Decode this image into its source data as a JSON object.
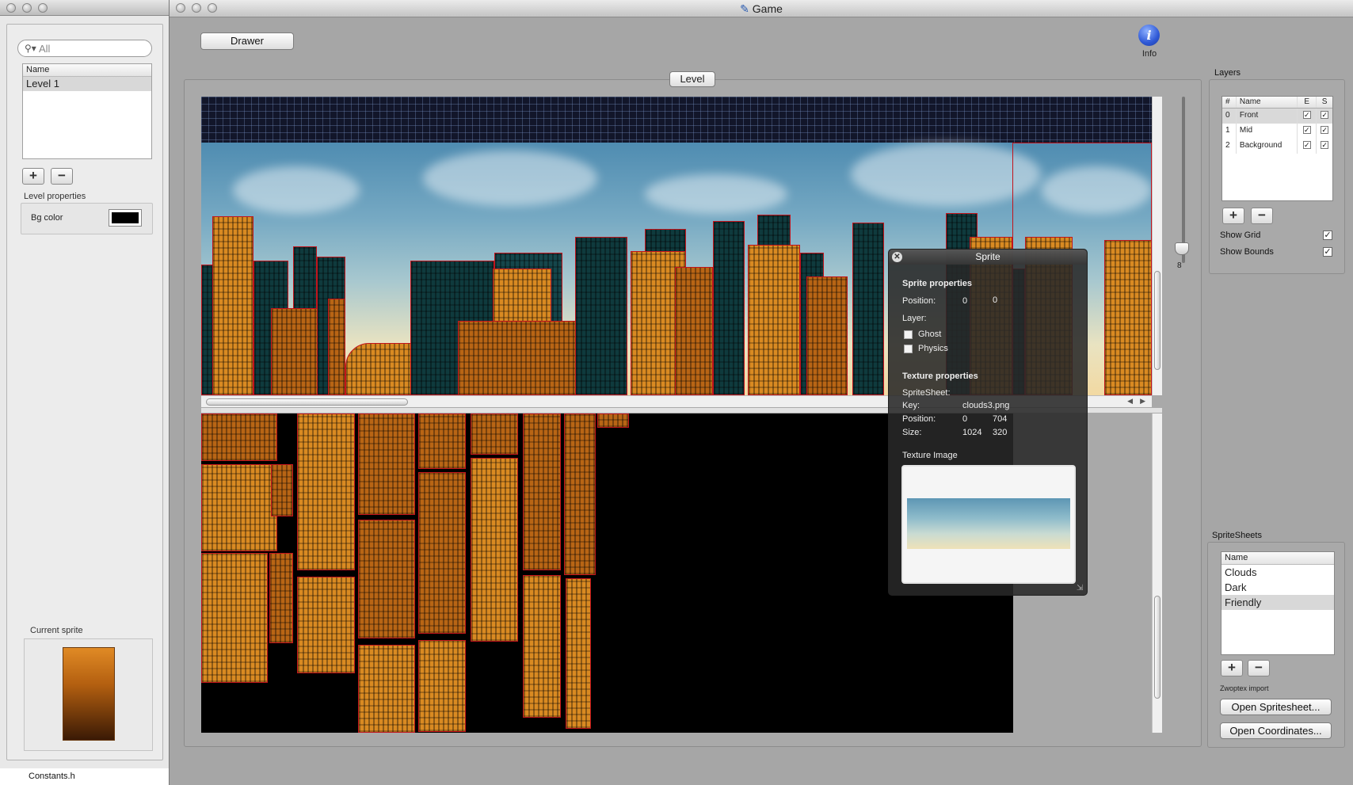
{
  "drawer": {
    "search_placeholder": "All",
    "list_header": "Name",
    "levels": [
      "Level 1"
    ],
    "add_label": "+",
    "remove_label": "−",
    "level_properties_title": "Level properties",
    "bg_color_label": "Bg color",
    "bg_color": "#000000",
    "current_sprite_title": "Current sprite"
  },
  "background_file": "Constants.h",
  "window": {
    "title": "Game",
    "drawer_button": "Drawer",
    "info_label": "Info",
    "info_glyph": "i",
    "level_tab": "Level",
    "zoom_value": "8"
  },
  "layers": {
    "title": "Layers",
    "headers": [
      "#",
      "Name",
      "E",
      "S"
    ],
    "rows": [
      {
        "num": "0",
        "name": "Front",
        "e": true,
        "s": true
      },
      {
        "num": "1",
        "name": "Mid",
        "e": true,
        "s": true
      },
      {
        "num": "2",
        "name": "Background",
        "e": true,
        "s": true
      }
    ],
    "add_label": "+",
    "remove_label": "−",
    "show_grid": "Show Grid",
    "show_grid_checked": true,
    "show_bounds": "Show Bounds",
    "show_bounds_checked": true
  },
  "spritesheets": {
    "title": "SpriteSheets",
    "header": "Name",
    "items": [
      "Clouds",
      "Dark",
      "Friendly"
    ],
    "selected": "Friendly",
    "add_label": "+",
    "remove_label": "−",
    "zwoptex_label": "Zwoptex import",
    "open_spritesheet": "Open Spritesheet...",
    "open_coordinates": "Open Coordinates..."
  },
  "sprite_hud": {
    "title": "Sprite",
    "close_glyph": "✕",
    "sprite_properties": "Sprite properties",
    "position_label": "Position:",
    "position_x": "0",
    "position_y": "0",
    "layer_label": "Layer:",
    "ghost_label": "Ghost",
    "physics_label": "Physics",
    "texture_properties": "Texture properties",
    "spritesheet_label": "SpriteSheet:",
    "key_label": "Key:",
    "key_value": "clouds3.png",
    "tex_position_label": "Position:",
    "tex_position_x": "0",
    "tex_position_y": "704",
    "size_label": "Size:",
    "size_w": "1024",
    "size_h": "320",
    "texture_image_label": "Texture Image"
  }
}
